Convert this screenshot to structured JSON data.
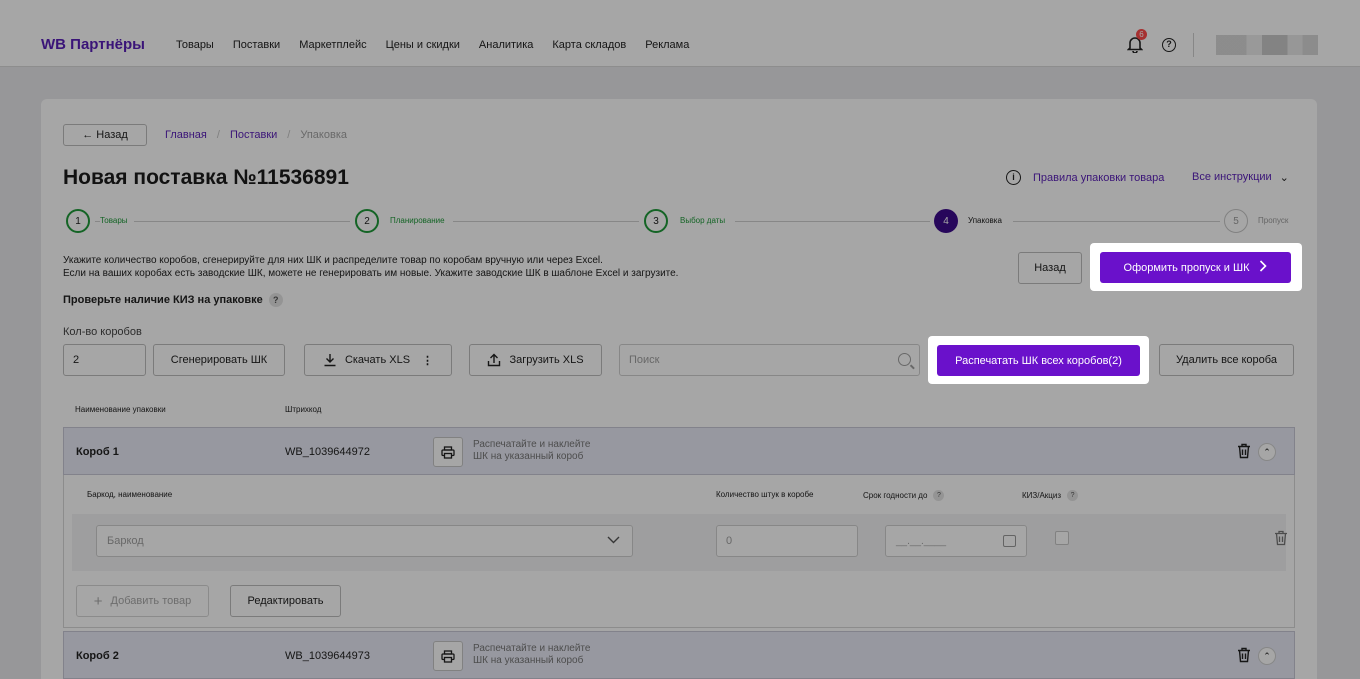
{
  "header": {
    "logo": "WB Партнёры",
    "nav": [
      "Товары",
      "Поставки",
      "Маркетплейс",
      "Цены и скидки",
      "Аналитика",
      "Карта складов",
      "Реклама"
    ],
    "notifications_count": "6",
    "help_icon": "?"
  },
  "page": {
    "back_label": "← Назад",
    "breadcrumbs": [
      "Главная",
      "Поставки",
      "Упаковка"
    ],
    "title": "Новая поставка №11536891",
    "info_icon": "i",
    "rules_link": "Правила упаковки товара",
    "all_instructions": "Все инструкции",
    "chevron": "⌄"
  },
  "stepper": {
    "steps": [
      {
        "num": "1",
        "label": "Товары",
        "state": "done"
      },
      {
        "num": "2",
        "label": "Планирование",
        "state": "done"
      },
      {
        "num": "3",
        "label": "Выбор даты",
        "state": "done"
      },
      {
        "num": "4",
        "label": "Упаковка",
        "state": "active"
      },
      {
        "num": "5",
        "label": "Пропуск",
        "state": "todo"
      }
    ]
  },
  "instructions": {
    "line1": "Укажите количество коробов, сгенерируйте для них ШК и распределите товар по коробам вручную или через Excel.",
    "line2": "Если на ваших коробах есть заводские ШК, можете не генерировать им новые. Укажите заводские ШК в шаблоне Excel и загрузите.",
    "kiz_check": "Проверьте наличие КИЗ на упаковке",
    "q": "?"
  },
  "actions": {
    "back": "Назад",
    "submit": "Оформить пропуск и ШК",
    "submit_arrow": "›"
  },
  "toolbar": {
    "boxes_label": "Кол-во коробов",
    "boxes_value": "2",
    "generate": "Сгенерировать ШК",
    "download": "Скачать XLS",
    "upload": "Загрузить XLS",
    "search_placeholder": "Поиск",
    "print_all": "Распечатать ШК всех коробов(2)",
    "delete_all": "Удалить все короба"
  },
  "table": {
    "col_name": "Наименование упаковки",
    "col_barcode": "Штрихкод"
  },
  "boxes": [
    {
      "name": "Короб 1",
      "code": "WB_1039644972",
      "hint1": "Распечатайте и наклейте",
      "hint2": "ШК на указанный короб"
    },
    {
      "name": "Короб 2",
      "code": "WB_1039644973",
      "hint1": "Распечатайте и наклейте",
      "hint2": "ШК на указанный короб"
    }
  ],
  "box_items": {
    "col_barcode": "Баркод, наименование",
    "col_qty": "Количество штук в коробе",
    "col_expiry": "Срок годности до",
    "col_kiz": "КИЗ/Акциз",
    "barcode_placeholder": "Баркод",
    "qty_placeholder": "0",
    "date_placeholder": "__.__.____",
    "add_item": "Добавить товар",
    "edit": "Редактировать"
  },
  "colors": {
    "accent": "#6a11cb",
    "brand": "#5a1fb8",
    "done": "#1f9a3a",
    "active_step": "#3d0c8c"
  }
}
